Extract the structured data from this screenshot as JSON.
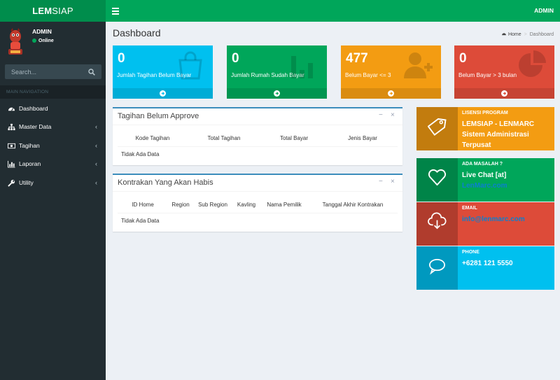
{
  "header": {
    "logo_bold": "LEM",
    "logo_rest": "SIAP",
    "user": "ADMIN"
  },
  "sidebar": {
    "user_name": "ADMIN",
    "status": "Online",
    "search_placeholder": "Search...",
    "nav_header": "MAIN NAVIGATION",
    "items": [
      {
        "label": "Dashboard",
        "icon": "dashboard-icon"
      },
      {
        "label": "Master Data",
        "icon": "sitemap-icon"
      },
      {
        "label": "Tagihan",
        "icon": "money-icon"
      },
      {
        "label": "Laporan",
        "icon": "bar-chart-icon"
      },
      {
        "label": "Utility",
        "icon": "wrench-icon"
      }
    ]
  },
  "page": {
    "title": "Dashboard",
    "breadcrumb": {
      "home": "Home",
      "current": "Dashboard"
    }
  },
  "stats": [
    {
      "value": "0",
      "label": "Jumlah Tagihan Belum Bayar",
      "color": "#00c0ef",
      "icon": "shopping-bag-icon"
    },
    {
      "value": "0",
      "label": "Jumlah Rumah Sudah Bayar",
      "color": "#00a65a",
      "icon": "bar-chart-icon"
    },
    {
      "value": "477",
      "label": "Belum Bayar <= 3",
      "color": "#f39c12",
      "icon": "user-plus-icon"
    },
    {
      "value": "0",
      "label": "Belum Bayar > 3 bulan",
      "color": "#dd4b39",
      "icon": "pie-chart-icon"
    }
  ],
  "panels": {
    "tagihan": {
      "title": "Tagihan Belum Approve",
      "columns": [
        "Kode Tagihan",
        "Total Tagihan",
        "Total Bayar",
        "Jenis Bayar"
      ],
      "empty": "Tidak Ada Data"
    },
    "kontrakan": {
      "title": "Kontrakan Yang Akan Habis",
      "columns": [
        "ID Home",
        "Region",
        "Sub Region",
        "Kavling",
        "Nama Pemilik",
        "Tanggal Akhir Kontrakan"
      ],
      "empty": "Tidak Ada Data"
    }
  },
  "info": [
    {
      "title": "LISENSI PROGRAM",
      "value": "LEMSIAP - LENMARC Sistem Administrasi Terpusat",
      "color": "#f39c12",
      "icon": "tag-icon"
    },
    {
      "title": "ADA MASALAH ?",
      "value": "Live Chat [at]",
      "link": "LenMarc.com",
      "color": "#00a65a",
      "icon": "heart-icon"
    },
    {
      "title": "EMAIL",
      "link": "info@lenmarc.com",
      "color": "#dd4b39",
      "icon": "cloud-download-icon"
    },
    {
      "title": "PHONE",
      "value": "+6281 121 5550",
      "color": "#00c0ef",
      "icon": "comment-icon"
    }
  ]
}
